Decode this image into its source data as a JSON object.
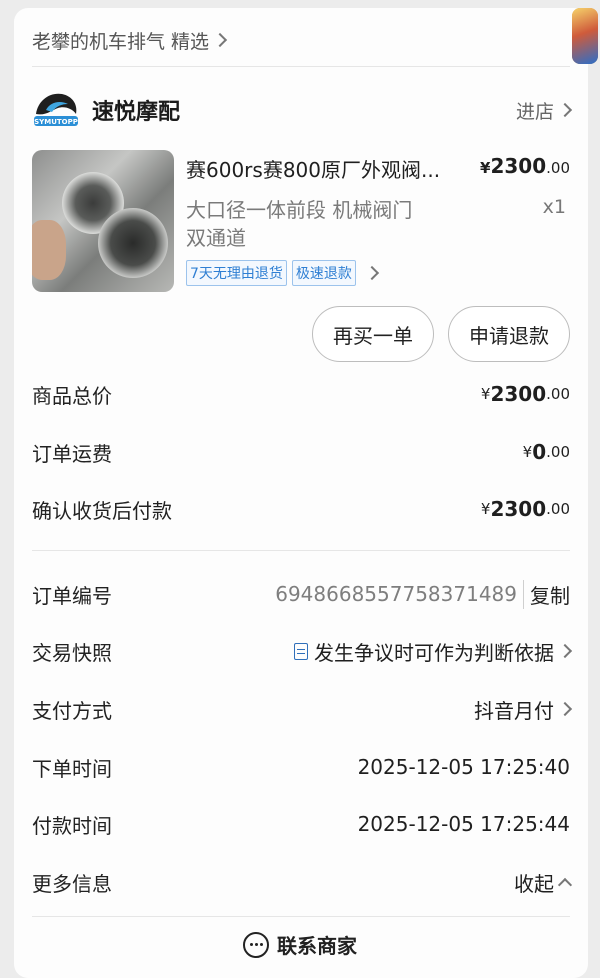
{
  "breadcrumb": {
    "text": "老攀的机车排气 精选"
  },
  "store": {
    "name": "速悦摩配",
    "logo_text": "SYMUTOPP",
    "enter_label": "进店"
  },
  "product": {
    "title": "赛600rs赛800原厂外观阀...",
    "price_symbol": "¥",
    "price_main": "2300",
    "price_decimal": ".00",
    "spec_line1": "大口径一体前段 机械阀门",
    "spec_line2": "双通道",
    "quantity": "x1",
    "tags": [
      "7天无理由退货",
      "极速退款"
    ]
  },
  "actions": {
    "rebuy": "再买一单",
    "refund": "申请退款"
  },
  "summary": {
    "total_label": "商品总价",
    "total_symbol": "¥",
    "total_main": "2300",
    "total_decimal": ".00",
    "shipping_label": "订单运费",
    "shipping_symbol": "¥",
    "shipping_main": "0",
    "shipping_decimal": ".00",
    "pay_after_label": "确认收货后付款",
    "pay_after_symbol": "¥",
    "pay_after_main": "2300",
    "pay_after_decimal": ".00"
  },
  "details": {
    "order_no_label": "订单编号",
    "order_no": "6948668557758371489",
    "copy_label": "复制",
    "snapshot_label": "交易快照",
    "snapshot_value": "发生争议时可作为判断依据",
    "payment_label": "支付方式",
    "payment_value": "抖音月付",
    "order_time_label": "下单时间",
    "order_time": "2025-12-05 17:25:40",
    "pay_time_label": "付款时间",
    "pay_time": "2025-12-05 17:25:44",
    "more_label": "更多信息",
    "collapse_label": "收起"
  },
  "contact": {
    "label": "联系商家"
  },
  "colors": {
    "accent_red": "#e4394a",
    "link_blue": "#2f6fba",
    "tag_blue": "#2f7fd3"
  }
}
